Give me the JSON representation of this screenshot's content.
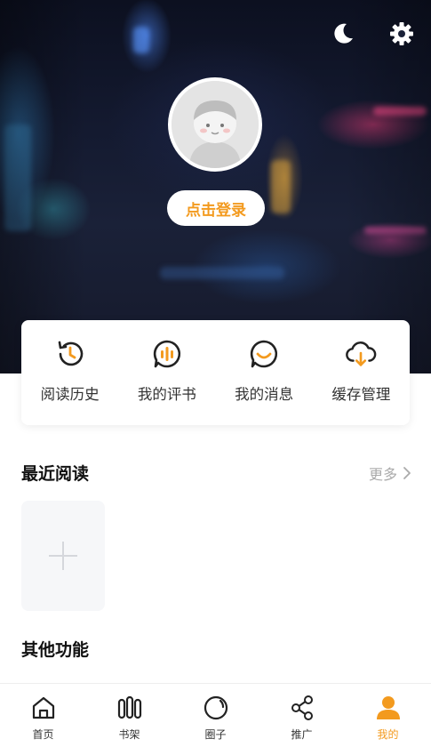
{
  "header": {
    "login_label": "点击登录",
    "icons": [
      "moon-icon",
      "settings-gear-icon"
    ]
  },
  "quick_actions": [
    {
      "label": "阅读历史",
      "icon": "history-clock-icon"
    },
    {
      "label": "我的评书",
      "icon": "review-audio-icon"
    },
    {
      "label": "我的消息",
      "icon": "message-bubble-icon"
    },
    {
      "label": "缓存管理",
      "icon": "cloud-download-icon"
    }
  ],
  "recent": {
    "title": "最近阅读",
    "more_label": "更多"
  },
  "other": {
    "title": "其他功能"
  },
  "tabs": [
    {
      "label": "首页",
      "icon": "home-icon"
    },
    {
      "label": "书架",
      "icon": "bookshelf-icon"
    },
    {
      "label": "圈子",
      "icon": "circle-icon"
    },
    {
      "label": "推广",
      "icon": "share-icon"
    },
    {
      "label": "我的",
      "icon": "profile-icon",
      "active": true
    }
  ],
  "colors": {
    "accent": "#f39a1e",
    "muted_text": "#aaaaaa"
  }
}
